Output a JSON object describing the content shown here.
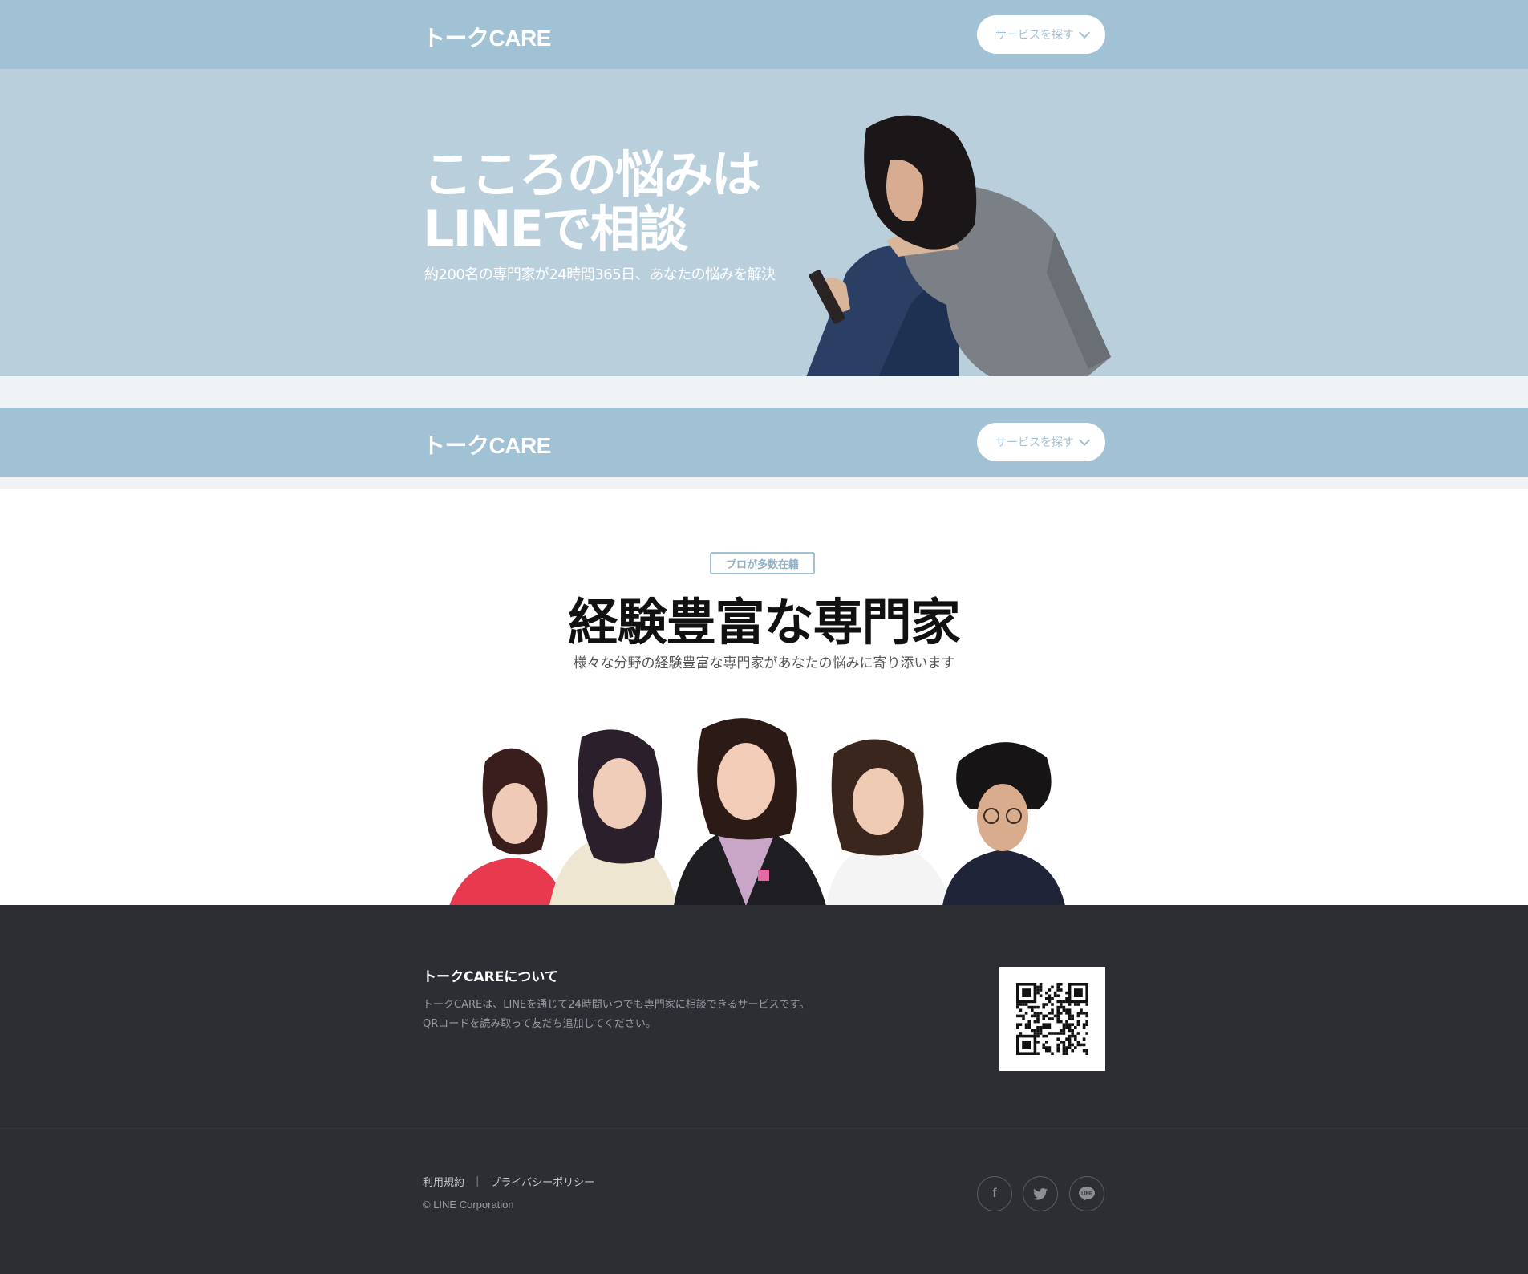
{
  "header": {
    "logo": "トークCARE",
    "menu_button_label": "サービスを探す"
  },
  "hero": {
    "headline_line1": "こころの悩みは",
    "headline_line2": "LINEで相談",
    "subtitle": "約200名の専門家が24時間365日、あなたの悩みを解決"
  },
  "experts": {
    "tag": "プロが多数在籍",
    "title": "経験豊富な専門家",
    "description": "様々な分野の経験豊富な専門家があなたの悩みに寄り添います"
  },
  "footer": {
    "heading": "トークCAREについて",
    "text_line1": "トークCAREは、LINEを通じて24時間いつでも専門家に相談できるサービスです。",
    "text_line2": "QRコードを読み取って友だち追加してください。",
    "link_terms": "利用規約",
    "link_separator": "|",
    "link_privacy": "プライバシーポリシー",
    "copyright": "© LINE Corporation",
    "social_facebook": "f",
    "social_line": "LINE"
  },
  "colors": {
    "header_blue": "#a1c1d4",
    "hero_blue": "#bacfdc",
    "footer_dark": "#2d2e33"
  }
}
